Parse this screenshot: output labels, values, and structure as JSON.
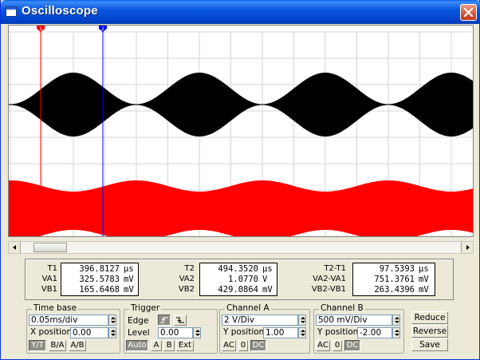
{
  "window": {
    "title": "Oscilloscope"
  },
  "colors": {
    "channel_a": "#000000",
    "channel_b": "#ff0000",
    "cursor_1": "#ff0000",
    "cursor_2": "#0000ff",
    "grid": "#d4d4d4"
  },
  "cursors": {
    "t1_marker": "1",
    "t2_marker": "2"
  },
  "readout": {
    "col1": {
      "t_label": "T1",
      "t_value": "396.8127",
      "t_unit": "µs",
      "a_label": "VA1",
      "a_value": "325.5783",
      "a_unit": "mV",
      "b_label": "VB1",
      "b_value": "165.6468",
      "b_unit": "mV"
    },
    "col2": {
      "t_label": "T2",
      "t_value": "494.3520",
      "t_unit": "µs",
      "a_label": "VA2",
      "a_value": "1.0770",
      "a_unit": "V",
      "b_label": "VB2",
      "b_value": "429.0864",
      "b_unit": "mV"
    },
    "col3": {
      "t_label": "T2-T1",
      "t_value": "97.5393",
      "t_unit": "µs",
      "a_label": "VA2-VA1",
      "a_value": "751.3761",
      "a_unit": "mV",
      "b_label": "VB2-VB1",
      "b_value": "263.4396",
      "b_unit": "mV"
    }
  },
  "timebase": {
    "title": "Time base",
    "value": "0.05ms/div",
    "xpos_label": "X position",
    "xpos_value": "0.00",
    "yt": "Y/T",
    "ba": "B/A",
    "ab": "A/B"
  },
  "trigger": {
    "title": "Trigger",
    "edge_label": "Edge",
    "level_label": "Level",
    "level_value": "0.00",
    "auto": "Auto",
    "a": "A",
    "b": "B",
    "ext": "Ext"
  },
  "channel_a": {
    "title": "Channel A",
    "value": "2 V/Div",
    "ypos_label": "Y position",
    "ypos_value": "1.00",
    "ac": "AC",
    "zero": "0",
    "dc": "DC"
  },
  "channel_b": {
    "title": "Channel B",
    "value": "500 mV/Div",
    "ypos_label": "Y position",
    "ypos_value": "-2.00",
    "ac": "AC",
    "zero": "0",
    "dc": "DC"
  },
  "actions": {
    "reduce": "Reduce",
    "reverse": "Reverse",
    "save": "Save"
  }
}
